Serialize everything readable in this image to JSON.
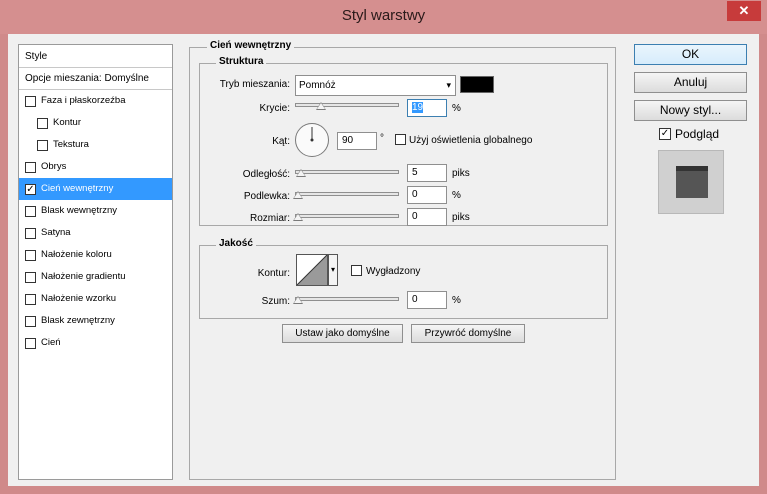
{
  "window": {
    "title": "Styl warstwy",
    "close_glyph": "✕"
  },
  "style_list": {
    "header": "Style",
    "blend_item": "Opcje mieszania: Domyślne",
    "items": [
      {
        "label": "Faza i płaskorzeźba",
        "checked": false
      },
      {
        "label": "Kontur",
        "checked": false
      },
      {
        "label": "Tekstura",
        "checked": false
      },
      {
        "label": "Obrys",
        "checked": false
      },
      {
        "label": "Cień wewnętrzny",
        "checked": true
      },
      {
        "label": "Blask wewnętrzny",
        "checked": false
      },
      {
        "label": "Satyna",
        "checked": false
      },
      {
        "label": "Nałożenie koloru",
        "checked": false
      },
      {
        "label": "Nałożenie gradientu",
        "checked": false
      },
      {
        "label": "Nałożenie wzorku",
        "checked": false
      },
      {
        "label": "Blask zewnętrzny",
        "checked": false
      },
      {
        "label": "Cień",
        "checked": false
      }
    ]
  },
  "section_title": "Cień wewnętrzny",
  "structure": {
    "legend": "Struktura",
    "blend_mode_label": "Tryb mieszania:",
    "blend_mode_value": "Pomnóż",
    "color_hex": "#000000",
    "opacity_label": "Krycie:",
    "opacity_value": "19",
    "opacity_unit": "%",
    "angle_label": "Kąt:",
    "angle_value": "90",
    "angle_unit": "°",
    "global_light_label": "Użyj oświetlenia globalnego",
    "global_light_checked": false,
    "distance_label": "Odległość:",
    "distance_value": "5",
    "distance_unit": "piks",
    "choke_label": "Podlewka:",
    "choke_value": "0",
    "choke_unit": "%",
    "size_label": "Rozmiar:",
    "size_value": "0",
    "size_unit": "piks"
  },
  "quality": {
    "legend": "Jakość",
    "contour_label": "Kontur:",
    "anti_alias_label": "Wygładzony",
    "anti_alias_checked": false,
    "noise_label": "Szum:",
    "noise_value": "0",
    "noise_unit": "%"
  },
  "buttons": {
    "make_default": "Ustaw jako domyślne",
    "reset_default": "Przywróć domyślne",
    "ok": "OK",
    "cancel": "Anuluj",
    "new_style": "Nowy styl...",
    "preview_label": "Podgląd",
    "preview_checked": true
  },
  "colors": {
    "accent": "#3399ff",
    "titlebar": "#d58f8f",
    "close": "#c73b3b"
  }
}
